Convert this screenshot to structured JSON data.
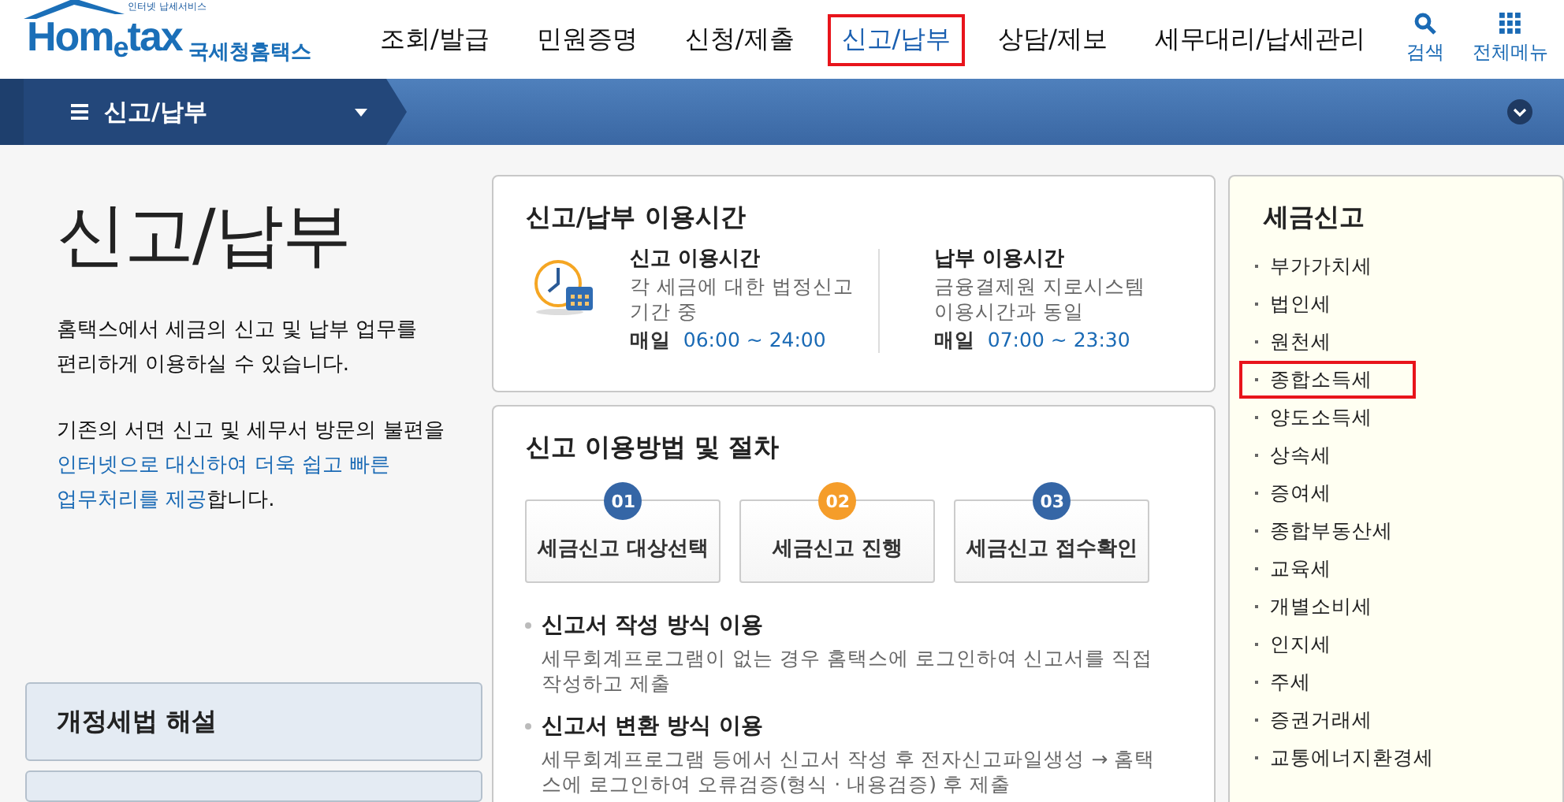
{
  "logo": {
    "tagline": "인터넷 납세서비스",
    "wordmark": "Hom$_{e}$tax",
    "name": "국세청홈택스"
  },
  "menu": [
    {
      "label": "조회/발급",
      "selected": false,
      "highlighted": false
    },
    {
      "label": "민원증명",
      "selected": false,
      "highlighted": false
    },
    {
      "label": "신청/제출",
      "selected": false,
      "highlighted": false
    },
    {
      "label": "신고/납부",
      "selected": true,
      "highlighted": true
    },
    {
      "label": "상담/제보",
      "selected": false,
      "highlighted": false
    },
    {
      "label": "세무대리/납세관리",
      "selected": false,
      "highlighted": false
    }
  ],
  "header_tools": [
    {
      "kind": "search",
      "label": "검색"
    },
    {
      "kind": "grid",
      "label": "전체메뉴"
    }
  ],
  "breadcrumb": {
    "label": "신고/납부"
  },
  "intro": {
    "title": "신고/납부",
    "paragraph_1": [
      "홈택스에서 세금의 신고 및 납부 업무를",
      "편리하게 이용하실 수 있습니다."
    ],
    "paragraph_2": {
      "before": "기존의 서면 신고 및 세무서 방문의 불편을",
      "emphasis": [
        "인터넷으로 대신하여 더욱 쉽고 빠른",
        "업무처리를 제공"
      ],
      "after": "합니다."
    }
  },
  "side_panels": [
    {
      "kind": "labeled",
      "label": "개정세법 해설"
    },
    {
      "kind": "cut"
    }
  ],
  "hours": {
    "title": "신고/납부 이용시간",
    "columns": [
      {
        "heading": "신고 이용시간",
        "description": "각 세금에 대한 법정신고 기간 중",
        "day": "매일",
        "time": "06:00 ~ 24:00"
      },
      {
        "heading": "납부 이용시간",
        "description": "금융결제원 지로시스템 이용시간과 동일",
        "day": "매일",
        "time": "07:00 ~ 23:30"
      }
    ]
  },
  "procedure": {
    "title": "신고 이용방법 및 절차",
    "steps": [
      {
        "number": "01",
        "label": "세금신고 대상선택",
        "color": "#3566a6"
      },
      {
        "number": "02",
        "label": "세금신고 진행",
        "color": "#f59d2a"
      },
      {
        "number": "03",
        "label": "세금신고 접수확인",
        "color": "#3566a6"
      }
    ],
    "methods": [
      {
        "heading": "신고서 작성 방식 이용",
        "description": "세무회계프로그램이 없는 경우 홈택스에 로그인하여 신고서를 직접 작성하고 제출"
      },
      {
        "heading": "신고서 변환 방식 이용",
        "description": "세무회계프로그램 등에서 신고서 작성 후 전자신고파일생성 → 홈택스에 로그인하여 오류검증(형식 · 내용검증) 후 제출"
      }
    ]
  },
  "tax_filing": {
    "title": "세금신고",
    "items": [
      {
        "label": "부가가치세",
        "highlighted": false
      },
      {
        "label": "법인세",
        "highlighted": false
      },
      {
        "label": "원천세",
        "highlighted": false
      },
      {
        "label": "종합소득세",
        "highlighted": true
      },
      {
        "label": "양도소득세",
        "highlighted": false
      },
      {
        "label": "상속세",
        "highlighted": false
      },
      {
        "label": "증여세",
        "highlighted": false
      },
      {
        "label": "종합부동산세",
        "highlighted": false
      },
      {
        "label": "교육세",
        "highlighted": false
      },
      {
        "label": "개별소비세",
        "highlighted": false
      },
      {
        "label": "인지세",
        "highlighted": false
      },
      {
        "label": "주세",
        "highlighted": false
      },
      {
        "label": "증권거래세",
        "highlighted": false
      },
      {
        "label": "교통에너지환경세",
        "highlighted": false
      }
    ]
  }
}
